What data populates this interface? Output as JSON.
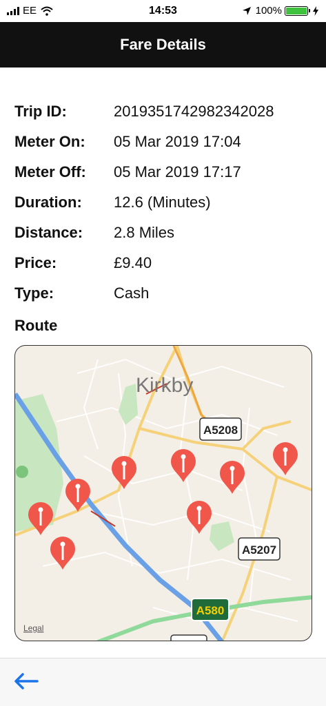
{
  "status": {
    "carrier": "EE",
    "time": "14:53",
    "battery": "100%"
  },
  "header": {
    "title": "Fare Details"
  },
  "fields": [
    {
      "label": "Trip ID:",
      "value": "2019351742982342028"
    },
    {
      "label": "Meter On:",
      "value": "05 Mar 2019 17:04"
    },
    {
      "label": "Meter Off:",
      "value": "05 Mar 2019 17:17"
    },
    {
      "label": "Duration:",
      "value": "12.6 (Minutes)"
    },
    {
      "label": "Distance:",
      "value": "2.8 Miles"
    },
    {
      "label": "Price:",
      "value": "£9.40"
    },
    {
      "label": "Type:",
      "value": "Cash"
    }
  ],
  "route": {
    "title": "Route",
    "map": {
      "town": "Kirkby",
      "roads": [
        "A5208",
        "A5207",
        "A580"
      ],
      "legal": "Legal"
    }
  },
  "colors": {
    "header_bg": "#111111",
    "pin": "#f0564a",
    "motorway": "#6aa0e6",
    "trunk": "#8fd99a",
    "back_arrow": "#1a73e8"
  }
}
